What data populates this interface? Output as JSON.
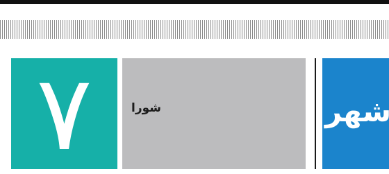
{
  "header": {
    "page_number": "۷",
    "section_label": "شورا",
    "category_label": "شهر"
  }
}
